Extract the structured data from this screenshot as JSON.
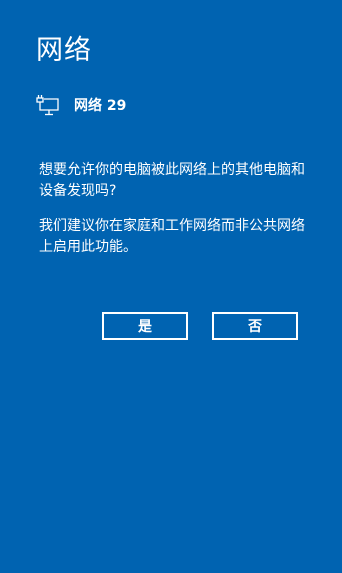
{
  "panel": {
    "title": "网络",
    "network": {
      "icon": "ethernet-monitor-icon",
      "name": "网络 29"
    },
    "message_line_1": "想要允许你的电脑被此网络上的其他电脑和设备发现吗?",
    "message_line_2": "我们建议你在家庭和工作网络而非公共网络上启用此功能。",
    "buttons": {
      "yes_label": "是",
      "no_label": "否"
    }
  },
  "colors": {
    "background": "#0063b1",
    "foreground": "#ffffff"
  }
}
